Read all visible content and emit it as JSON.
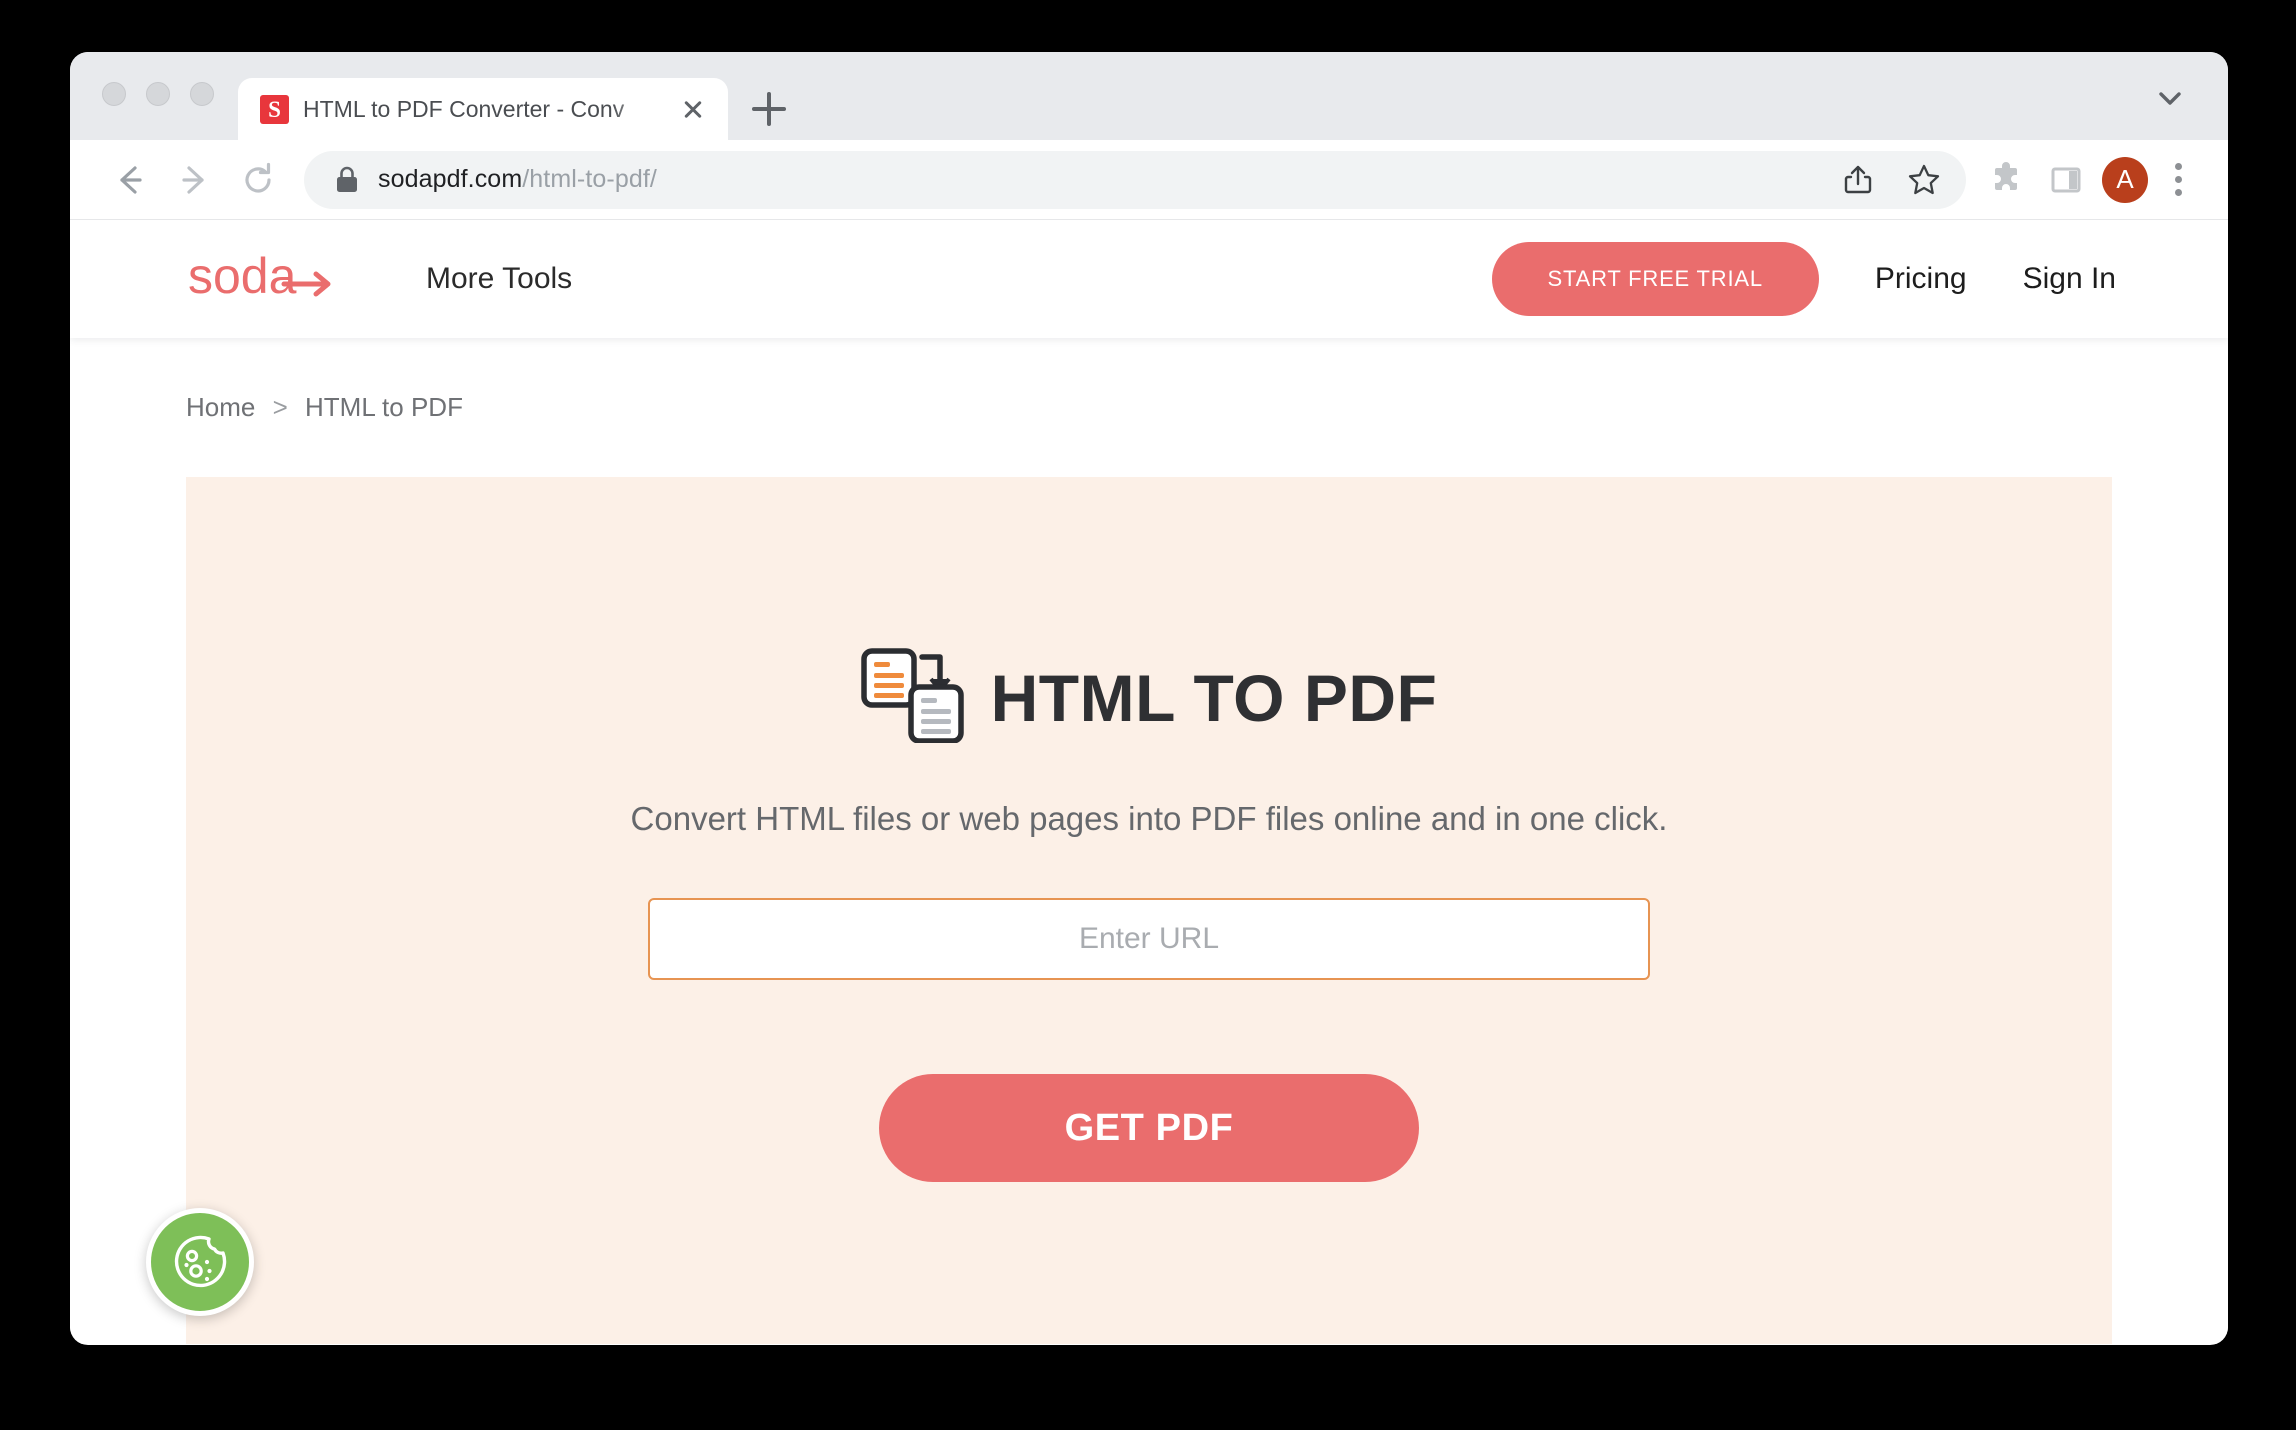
{
  "browser": {
    "tab": {
      "favicon_letter": "S",
      "title": "HTML to PDF Converter - Conv",
      "close_label": "",
      "icon_name": "sodapdf-favicon"
    },
    "new_tab_label": "",
    "toolbar": {
      "back_label": "",
      "forward_label": "",
      "reload_label": "",
      "url_domain": "sodapdf.com",
      "url_path": "/html-to-pdf/",
      "share_label": "",
      "bookmark_label": "",
      "extensions_label": "",
      "side_panel_label": "",
      "profile_initial": "A",
      "menu_label": ""
    }
  },
  "site": {
    "logo_text": "soda",
    "nav": {
      "more_tools": "More Tools",
      "start_free_trial": "START FREE TRIAL",
      "pricing": "Pricing",
      "sign_in": "Sign In"
    },
    "breadcrumb": {
      "home": "Home",
      "separator": ">",
      "current": "HTML to PDF"
    },
    "hero": {
      "title": "HTML TO PDF",
      "subtitle": "Convert HTML files or web pages into PDF files online and in one click.",
      "url_placeholder": "Enter URL",
      "url_value": "",
      "submit_label": "GET PDF"
    },
    "cookie_button_label": ""
  },
  "colors": {
    "brand_coral": "#ea6d6d",
    "hero_background": "#fcf0e7",
    "input_border": "#e79452",
    "cookie_green": "#7ebf58",
    "favicon_red": "#e8363c",
    "avatar_brown": "#b93f1c"
  }
}
